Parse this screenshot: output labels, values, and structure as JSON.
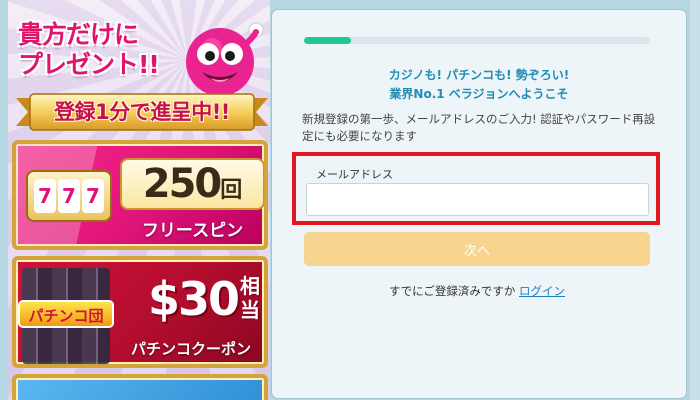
{
  "promo": {
    "headline_line1": "貴方だけに",
    "headline_line2": "プレゼント!!",
    "ribbon": "登録1分で進呈中!!",
    "free_spins": {
      "slot_reels": [
        "7",
        "7",
        "7"
      ],
      "amount": "250",
      "unit": "回",
      "label": "フリースピン"
    },
    "coupon": {
      "logo_text": "パチンコ団",
      "amount": "$30",
      "suffix": "相当",
      "label": "パチンコクーポン"
    }
  },
  "registration": {
    "progress_percent": 13.5,
    "welcome_line1": "カジノも! パチンコも! 勢ぞろい!",
    "welcome_line2": "業界No.1 ベラジョンへようこそ",
    "description": "新規登録の第一歩、メールアドレスのご入力! 認証やパスワード再設定にも必要になります",
    "email_label": "メールアドレス",
    "email_value": "",
    "next_button": "次へ",
    "already_registered": "すでにご登録済みですか",
    "login_link": "ログイン"
  },
  "colors": {
    "progress": "#22c98f",
    "welcome_text": "#1f8db5",
    "highlight_border": "#e0191f",
    "next_button_bg": "#f7d48f",
    "link": "#1f7fc0",
    "brand_pink": "#e0147a"
  }
}
